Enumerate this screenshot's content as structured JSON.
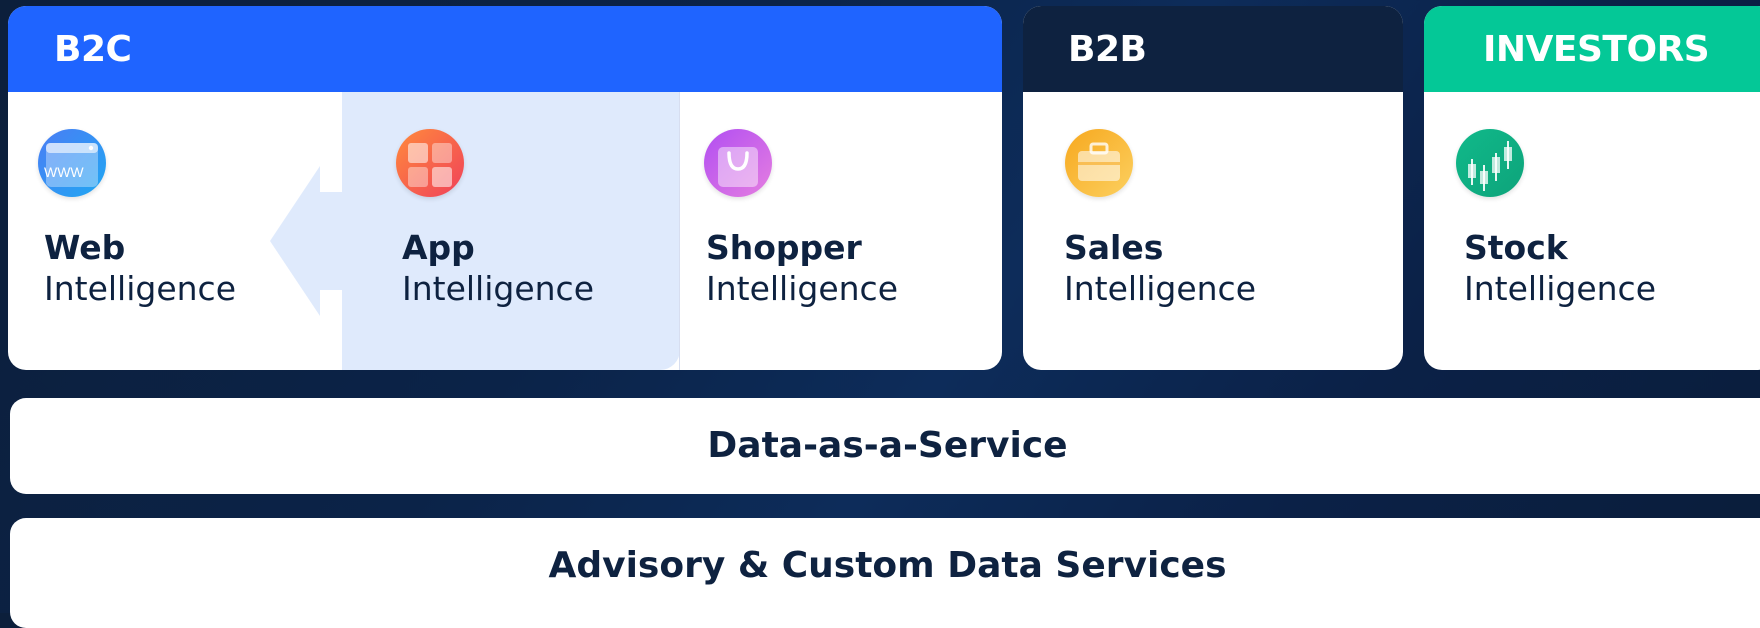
{
  "segments": {
    "b2c": {
      "label": "B2C",
      "color": "#1f64ff",
      "cards": [
        {
          "name": "Web",
          "suffix": "Intelligence",
          "icon": "web-browser-icon"
        },
        {
          "name": "App",
          "suffix": "Intelligence",
          "icon": "app-grid-icon"
        },
        {
          "name": "Shopper",
          "suffix": "Intelligence",
          "icon": "shopping-bag-icon"
        }
      ]
    },
    "b2b": {
      "label": "B2B",
      "color": "#0e2240",
      "cards": [
        {
          "name": "Sales",
          "suffix": "Intelligence",
          "icon": "briefcase-icon"
        }
      ]
    },
    "investors": {
      "label": "INVESTORS",
      "color": "#04c897",
      "cards": [
        {
          "name": "Stock",
          "suffix": "Intelligence",
          "icon": "candlestick-chart-icon"
        }
      ]
    }
  },
  "services": [
    {
      "label": "Data-as-a-Service"
    },
    {
      "label": "Advisory & Custom Data Services"
    }
  ],
  "icon_text": {
    "www": "WWW"
  }
}
